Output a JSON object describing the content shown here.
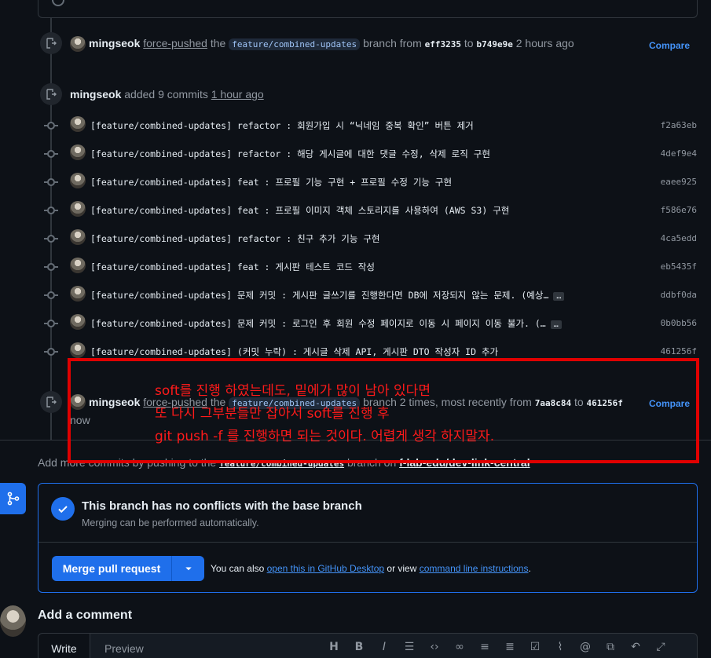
{
  "events": {
    "force_push_1": {
      "user": "mingseok",
      "action": "force-pushed",
      "the": "the",
      "branch": "feature/combined-updates",
      "branch_from": "branch from",
      "from_sha": "eff3235",
      "to": "to",
      "to_sha": "b749e9e",
      "time": "2 hours ago",
      "compare": "Compare"
    },
    "commits_added": {
      "user": "mingseok",
      "action": "added 9 commits",
      "time": "1 hour ago"
    },
    "force_push_2": {
      "user": "mingseok",
      "action": "force-pushed",
      "the": "the",
      "branch": "feature/combined-updates",
      "branch_times": "branch 2 times, most recently from",
      "from_sha": "7aa8c84",
      "to": "to",
      "to_sha": "461256f",
      "time": "now",
      "compare": "Compare"
    }
  },
  "commits": [
    {
      "message": "[feature/combined-updates] refactor : 회원가입 시 “닉네임 중복 확인” 버튼 제거",
      "sha": "f2a63eb"
    },
    {
      "message": "[feature/combined-updates] refactor : 해당 게시글에 대한 댓글 수정, 삭제 로직 구현",
      "sha": "4def9e4"
    },
    {
      "message": "[feature/combined-updates] feat : 프로필 기능 구현 + 프로필 수정 기능 구현",
      "sha": "eaee925"
    },
    {
      "message": "[feature/combined-updates] feat : 프로필 이미지 객체 스토리지를 사용하여 (AWS S3) 구현",
      "sha": "f586e76"
    },
    {
      "message": "[feature/combined-updates] refactor : 친구 추가 기능 구현",
      "sha": "4ca5edd"
    },
    {
      "message": "[feature/combined-updates] feat : 게시판 테스트 코드 작성",
      "sha": "eb5435f"
    },
    {
      "message": "[feature/combined-updates] 문제 커밋 : 게시판 글쓰기를 진행한다면 DB에 저장되지 않는 문제. (예상…",
      "sha": "ddbf0da",
      "ellipsis": "…"
    },
    {
      "message": "[feature/combined-updates] 문제 커밋 : 로그인 후 회원 수정 페이지로 이동 시 페이지 이동 불가. (…",
      "sha": "0b0bb56",
      "ellipsis": "…"
    },
    {
      "message": "[feature/combined-updates] (커밋 누락) : 게시글 삭제 API, 게시판 DTO 작성자 ID 추가",
      "sha": "461256f"
    }
  ],
  "add_more": {
    "prefix": "Add more commits by pushing to the",
    "branch": "feature/combined-updates",
    "middle": "branch on",
    "repo": "f-lab-edu/dev-link-central"
  },
  "merge": {
    "title": "This branch has no conflicts with the base branch",
    "subtitle": "Merging can be performed automatically.",
    "button": "Merge pull request",
    "note_prefix": "You can also",
    "link_desktop": "open this in GitHub Desktop",
    "note_middle": "or view",
    "link_cli": "command line instructions",
    "note_suffix": "."
  },
  "comment": {
    "title": "Add a comment",
    "tab_write": "Write",
    "tab_preview": "Preview",
    "toolbar": [
      "heading-icon",
      "bold-icon",
      "italic-icon",
      "quote-icon",
      "code-icon",
      "link-icon",
      "ordered-list-icon",
      "unordered-list-icon",
      "task-list-icon",
      "attach-icon",
      "mention-icon",
      "reference-icon",
      "reply-icon",
      "fullscreen-icon"
    ]
  },
  "annotation": {
    "line1": "soft를 진행 하였는데도, 밑에가 많이 남아 있다면",
    "line2": "또 다시 그부분들만 잡아서 soft를 진행 후",
    "line3": "git push -f 를 진행하면 되는 것이다. 어렵게 생각 하지말자.",
    "color": "#ff1a1a"
  },
  "colors": {
    "background": "#0d1117",
    "accent": "#1f6feb",
    "link": "#4493f8"
  }
}
